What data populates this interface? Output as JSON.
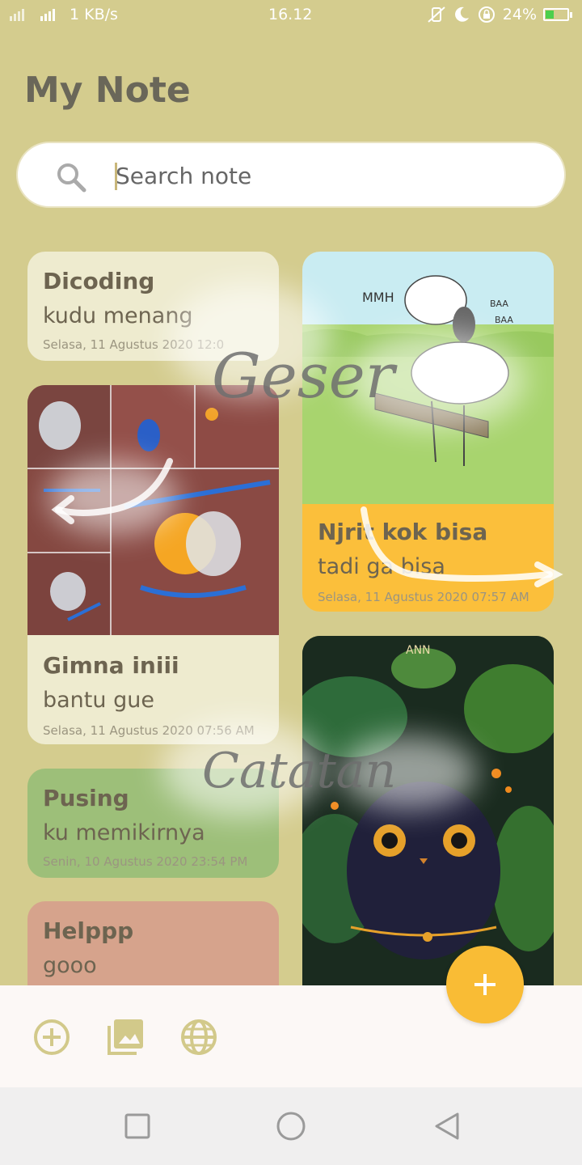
{
  "status_bar": {
    "network_speed": "1 KB/s",
    "time": "16.12",
    "battery": "24%"
  },
  "app": {
    "title": "My Note"
  },
  "search": {
    "placeholder": "Search note"
  },
  "notes": {
    "dicoding": {
      "title": "Dicoding",
      "body": "kudu menang",
      "date": "Selasa, 11 Agustus 2020 12:0"
    },
    "njrit": {
      "title": "Njrit kok bisa",
      "body": "tadi ga bisa",
      "date": "Selasa, 11 Agustus 2020 07:57 AM",
      "image_text": [
        "MMH",
        "BAA",
        "BAA"
      ]
    },
    "gimna": {
      "title": "Gimna iniii",
      "body": "bantu gue",
      "date": "Selasa, 11 Agustus 2020 07:56 AM"
    },
    "pusing": {
      "title": "Pusing",
      "body": "ku memikirnya",
      "date": "Senin, 10 Agustus 2020 23:54 PM"
    },
    "helppp": {
      "title": "Helppp",
      "body": "gooo"
    },
    "ann": {
      "image_label": "ANN"
    }
  },
  "overlay": {
    "swipe_text_1": "Geser",
    "swipe_text_2": "Catatan"
  },
  "colors": {
    "background": "#d4cc8e",
    "card_cream": "#eeebcf",
    "card_orange": "#fbbf3b",
    "card_green": "#9dbf79",
    "card_red": "#d6a38c",
    "fab": "#f9bc35",
    "icon": "#d2c98a"
  },
  "icons": [
    "search-icon",
    "add-circle-icon",
    "image-icon",
    "globe-icon",
    "plus-icon",
    "recent-apps-icon",
    "home-icon",
    "back-icon"
  ]
}
